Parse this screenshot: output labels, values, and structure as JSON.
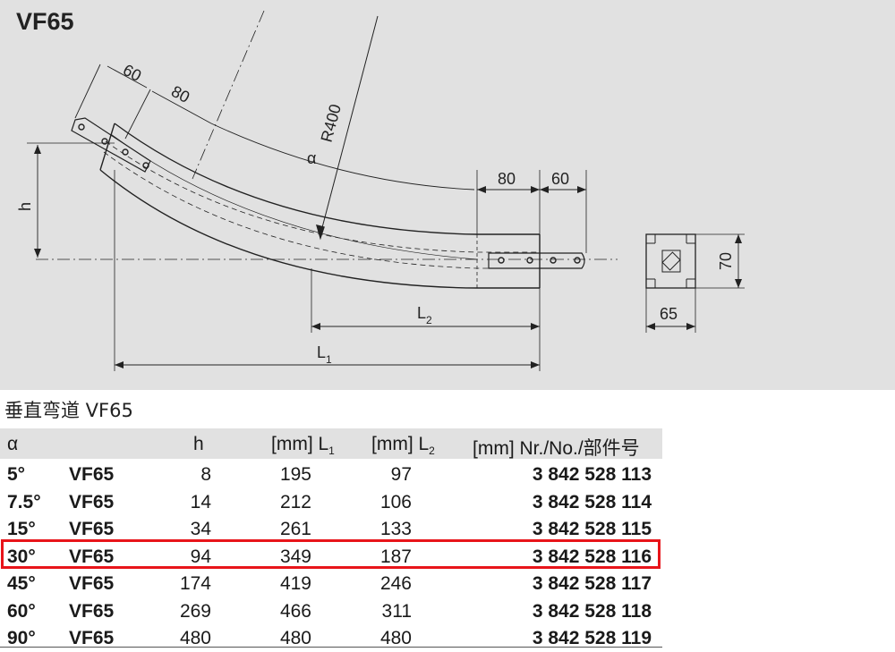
{
  "drawing": {
    "title": "VF65",
    "dimensions": {
      "d60_top": "60",
      "d80_top": "80",
      "radius": "R400",
      "alpha": "α",
      "h": "h",
      "d80_right": "80",
      "d60_right": "60",
      "l2": "L",
      "l2_sub": "2",
      "l1": "L",
      "l1_sub": "1",
      "d70": "70",
      "d65": "65"
    }
  },
  "table": {
    "caption": "垂直弯道 VF65",
    "headers": {
      "alpha": "α",
      "h": "h",
      "l1": "[mm] L",
      "l1_sub": "1",
      "l2": "[mm] L",
      "l2_sub": "2",
      "nr": "[mm] Nr./No./部件号"
    },
    "rows": [
      {
        "angle": "5°",
        "type": "VF65",
        "h": "8",
        "l1": "195",
        "l2": "97",
        "nr": "3 842 528 113"
      },
      {
        "angle": "7.5°",
        "type": "VF65",
        "h": "14",
        "l1": "212",
        "l2": "106",
        "nr": "3 842 528 114"
      },
      {
        "angle": "15°",
        "type": "VF65",
        "h": "34",
        "l1": "261",
        "l2": "133",
        "nr": "3 842 528 115"
      },
      {
        "angle": "30°",
        "type": "VF65",
        "h": "94",
        "l1": "349",
        "l2": "187",
        "nr": "3 842 528 116"
      },
      {
        "angle": "45°",
        "type": "VF65",
        "h": "174",
        "l1": "419",
        "l2": "246",
        "nr": "3 842 528 117"
      },
      {
        "angle": "60°",
        "type": "VF65",
        "h": "269",
        "l1": "466",
        "l2": "311",
        "nr": "3 842 528 118"
      },
      {
        "angle": "90°",
        "type": "VF65",
        "h": "480",
        "l1": "480",
        "l2": "480",
        "nr": "3 842 528 119"
      }
    ],
    "highlighted_row": "30°",
    "highlight_color": "#e8141a"
  }
}
